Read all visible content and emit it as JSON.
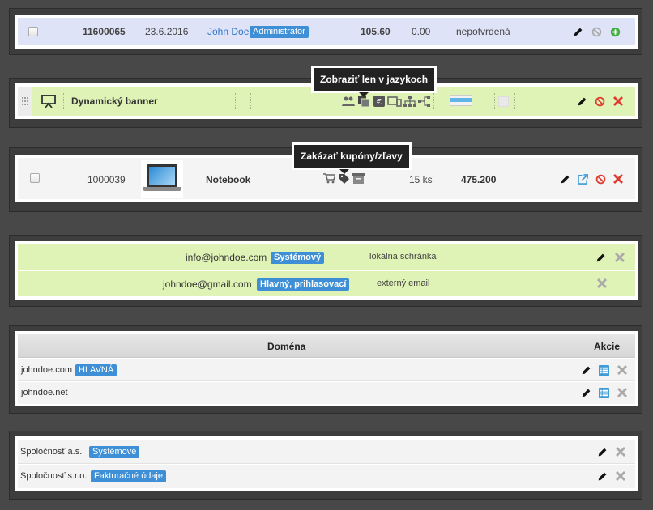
{
  "order_row": {
    "id": "11600065",
    "date": "23.6.2016",
    "name": "John Doe",
    "role_badge": "Administrátor",
    "amount": "105.60",
    "paid": "0.00",
    "status": "nepotvrdená"
  },
  "banner_row": {
    "tooltip": "Zobraziť len v jazykoch",
    "title": "Dynamický banner"
  },
  "product_row": {
    "tooltip": "Zakázať kupóny/zľavy",
    "id": "1000039",
    "name": "Notebook",
    "stock": "15 ks",
    "price": "475.200"
  },
  "emails": [
    {
      "address": "info@johndoe.com",
      "badge": "Systémový",
      "type": "lokálna schránka"
    },
    {
      "address": "johndoe@gmail.com",
      "badge": "Hlavný, prihlasovací",
      "type": "externý email"
    }
  ],
  "domains": {
    "header_domain": "Doména",
    "header_actions": "Akcie",
    "rows": [
      {
        "name": "johndoe.com",
        "badge": "HLAVNÁ"
      },
      {
        "name": "johndoe.net",
        "badge": ""
      }
    ]
  },
  "companies": [
    {
      "name": "Spoločnosť a.s.",
      "badge": "Systémové"
    },
    {
      "name": "Spoločnosť s.r.o.",
      "badge": "Fakturačné údaje"
    }
  ],
  "colors": {
    "accent_blue": "#3e8fd6",
    "row_green": "#e0f3b6",
    "row_lavender": "#dfe3f8",
    "delete_red": "#e03a2f",
    "add_green": "#3fae3f"
  },
  "icons": [
    "pencil-icon",
    "ban-icon",
    "plus-circle-icon",
    "close-icon",
    "external-link-icon",
    "list-icon",
    "drag-handle-icon",
    "presentation-icon",
    "users-icon",
    "language-icon",
    "euro-icon",
    "devices-icon",
    "sitemap-icon",
    "share-icon",
    "cart-icon",
    "tag-icon",
    "archive-icon"
  ]
}
